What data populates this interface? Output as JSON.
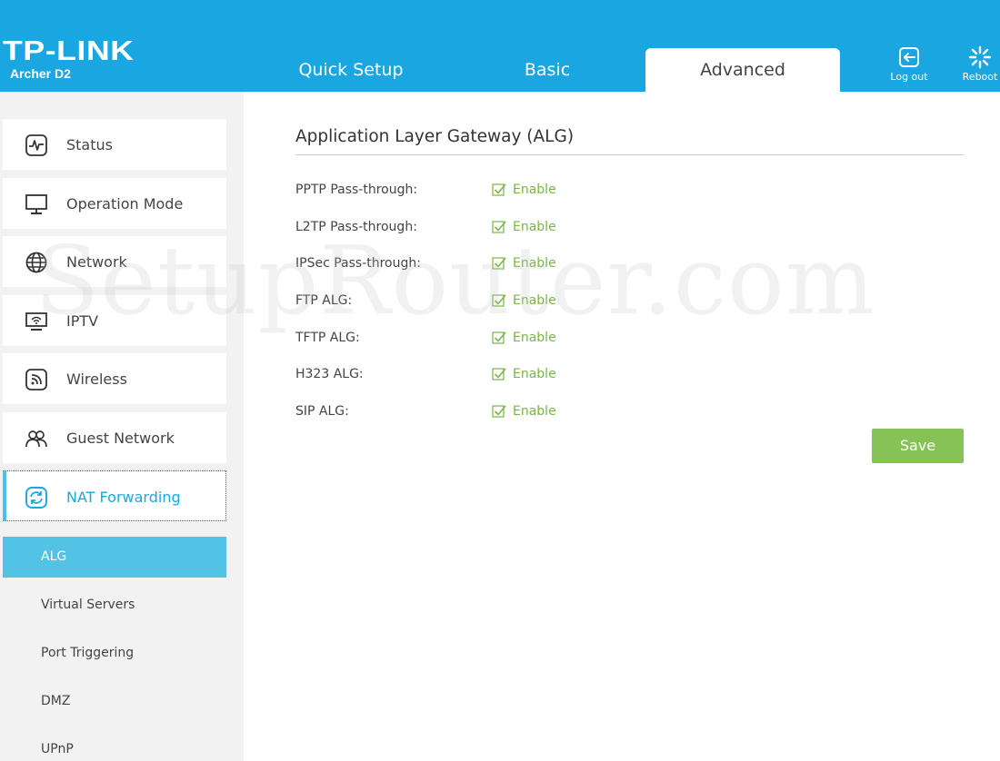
{
  "header": {
    "logo": "TP-LINK",
    "model": "Archer D2",
    "tabs": [
      {
        "label": "Quick Setup"
      },
      {
        "label": "Basic"
      },
      {
        "label": "Advanced"
      }
    ],
    "active_tab": "Advanced",
    "logout_label": "Log out",
    "reboot_label": "Reboot"
  },
  "sidebar": {
    "items": [
      {
        "label": "Status",
        "icon": "status-icon"
      },
      {
        "label": "Operation Mode",
        "icon": "monitor-icon"
      },
      {
        "label": "Network",
        "icon": "globe-icon"
      },
      {
        "label": "IPTV",
        "icon": "iptv-icon"
      },
      {
        "label": "Wireless",
        "icon": "wireless-icon"
      },
      {
        "label": "Guest Network",
        "icon": "guest-icon"
      },
      {
        "label": "NAT Forwarding",
        "icon": "nat-icon"
      }
    ],
    "active_item": "NAT Forwarding",
    "sub_items": [
      {
        "label": "ALG"
      },
      {
        "label": "Virtual Servers"
      },
      {
        "label": "Port Triggering"
      },
      {
        "label": "DMZ"
      },
      {
        "label": "UPnP"
      }
    ],
    "active_sub_item": "ALG"
  },
  "main": {
    "title": "Application Layer Gateway (ALG)",
    "rows": [
      {
        "label": "PPTP Pass-through:",
        "checkbox_label": "Enable",
        "checked": true
      },
      {
        "label": "L2TP Pass-through:",
        "checkbox_label": "Enable",
        "checked": true
      },
      {
        "label": "IPSec Pass-through:",
        "checkbox_label": "Enable",
        "checked": true
      },
      {
        "label": "FTP ALG:",
        "checkbox_label": "Enable",
        "checked": true
      },
      {
        "label": "TFTP ALG:",
        "checkbox_label": "Enable",
        "checked": true
      },
      {
        "label": "H323 ALG:",
        "checkbox_label": "Enable",
        "checked": true
      },
      {
        "label": "SIP ALG:",
        "checkbox_label": "Enable",
        "checked": true
      }
    ],
    "save_label": "Save"
  },
  "watermark": "SetupRouter.com",
  "colors": {
    "header_bg": "#1aa7e1",
    "accent": "#1aa7e1",
    "active_sub_bg": "#53c3e5",
    "enable_green": "#7ab547",
    "save_bg": "#86c256"
  }
}
